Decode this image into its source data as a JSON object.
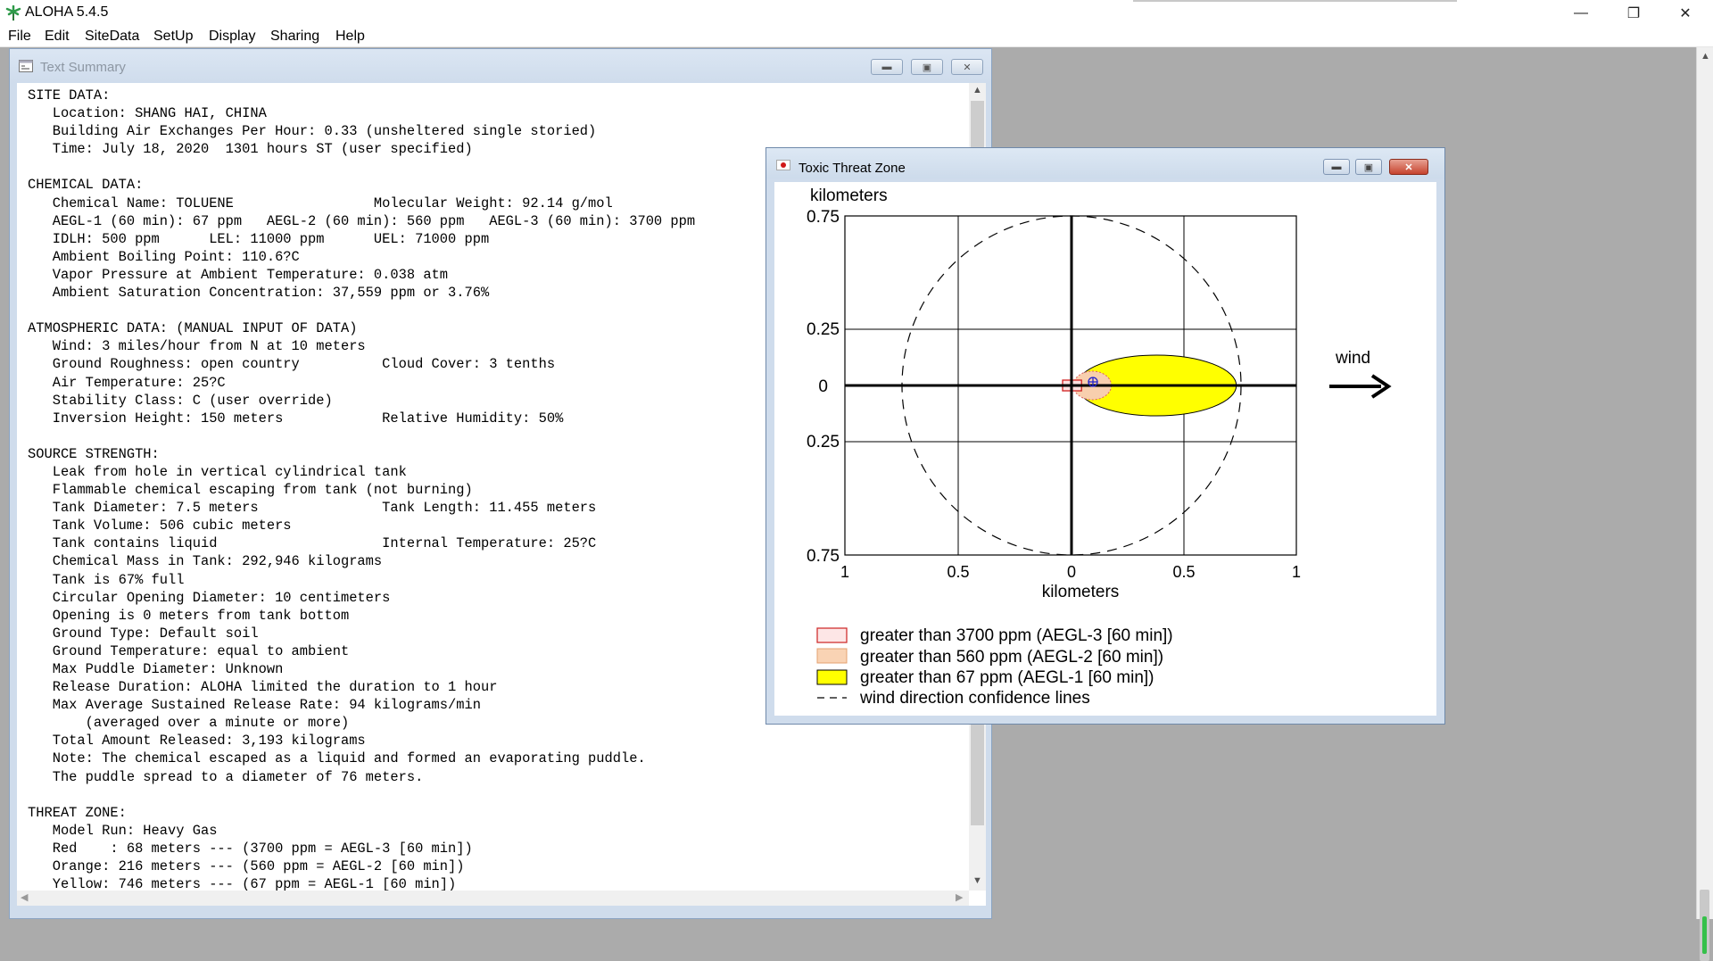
{
  "app": {
    "title": "ALOHA 5.4.5",
    "window_controls": {
      "minimize": "—",
      "restore": "❐",
      "close": "✕"
    }
  },
  "menu": [
    "File",
    "Edit",
    "SiteData",
    "SetUp",
    "Display",
    "Sharing",
    "Help"
  ],
  "text_summary": {
    "title": "Text Summary",
    "lines": [
      "SITE DATA:",
      "   Location: SHANG HAI, CHINA",
      "   Building Air Exchanges Per Hour: 0.33 (unsheltered single storied)",
      "   Time: July 18, 2020  1301 hours ST (user specified)",
      "",
      "CHEMICAL DATA:",
      "   Chemical Name: TOLUENE                 Molecular Weight: 92.14 g/mol",
      "   AEGL-1 (60 min): 67 ppm   AEGL-2 (60 min): 560 ppm   AEGL-3 (60 min): 3700 ppm",
      "   IDLH: 500 ppm      LEL: 11000 ppm      UEL: 71000 ppm",
      "   Ambient Boiling Point: 110.6?C",
      "   Vapor Pressure at Ambient Temperature: 0.038 atm",
      "   Ambient Saturation Concentration: 37,559 ppm or 3.76%",
      "",
      "ATMOSPHERIC DATA: (MANUAL INPUT OF DATA)",
      "   Wind: 3 miles/hour from N at 10 meters",
      "   Ground Roughness: open country          Cloud Cover: 3 tenths",
      "   Air Temperature: 25?C",
      "   Stability Class: C (user override)",
      "   Inversion Height: 150 meters            Relative Humidity: 50%",
      "",
      "SOURCE STRENGTH:",
      "   Leak from hole in vertical cylindrical tank",
      "   Flammable chemical escaping from tank (not burning)",
      "   Tank Diameter: 7.5 meters               Tank Length: 11.455 meters",
      "   Tank Volume: 506 cubic meters",
      "   Tank contains liquid                    Internal Temperature: 25?C",
      "   Chemical Mass in Tank: 292,946 kilograms",
      "   Tank is 67% full",
      "   Circular Opening Diameter: 10 centimeters",
      "   Opening is 0 meters from tank bottom",
      "   Ground Type: Default soil",
      "   Ground Temperature: equal to ambient",
      "   Max Puddle Diameter: Unknown",
      "   Release Duration: ALOHA limited the duration to 1 hour",
      "   Max Average Sustained Release Rate: 94 kilograms/min",
      "       (averaged over a minute or more)",
      "   Total Amount Released: 3,193 kilograms",
      "   Note: The chemical escaped as a liquid and formed an evaporating puddle.",
      "   The puddle spread to a diameter of 76 meters.",
      "",
      "THREAT ZONE:",
      "   Model Run: Heavy Gas",
      "   Red    : 68 meters --- (3700 ppm = AEGL-3 [60 min])",
      "   Orange: 216 meters --- (560 ppm = AEGL-2 [60 min])",
      "   Yellow: 746 meters --- (67 ppm = AEGL-1 [60 min])"
    ]
  },
  "threat_zone": {
    "title": "Toxic Threat Zone",
    "y_axis_title": "kilometers",
    "x_axis_title": "kilometers",
    "y_ticks": [
      "0.75",
      "0.25",
      "0",
      "0.25",
      "0.75"
    ],
    "x_ticks": [
      "1",
      "0.5",
      "0",
      "0.5",
      "1"
    ],
    "wind_label": "wind",
    "zones_km": {
      "red": 0.068,
      "orange": 0.216,
      "yellow": 0.746
    },
    "legend": [
      "greater than 3700 ppm (AEGL-3 [60 min])",
      "greater than 560 ppm (AEGL-2 [60 min])",
      "greater than 67 ppm (AEGL-1 [60 min])",
      "wind direction confidence lines"
    ],
    "colors": {
      "red": "#e03030",
      "orange": "#f4b183",
      "yellow": "#ffff00"
    }
  }
}
